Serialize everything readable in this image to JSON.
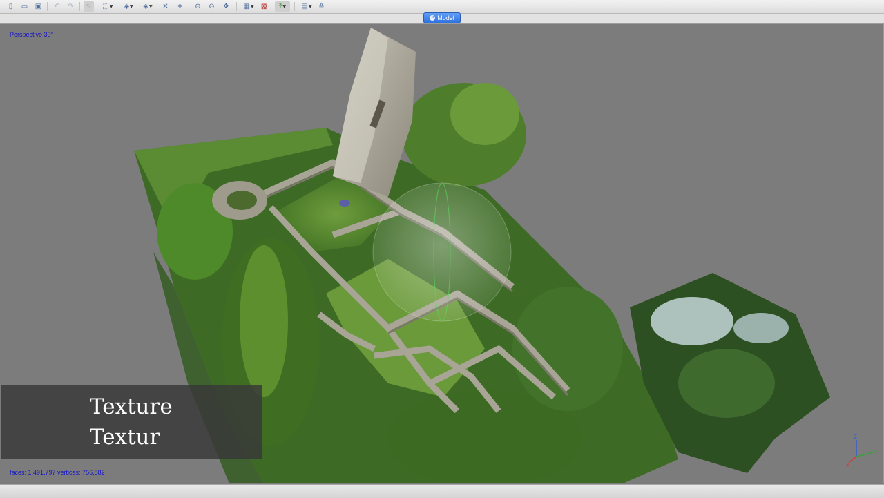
{
  "toolbar": {
    "buttons": [
      {
        "name": "new-file-icon",
        "glyph": "▯"
      },
      {
        "name": "open-folder-icon",
        "glyph": "▭"
      },
      {
        "name": "save-icon",
        "glyph": "▣"
      },
      {
        "name": "undo-icon",
        "glyph": "↶"
      },
      {
        "name": "redo-icon",
        "glyph": "↷"
      },
      {
        "name": "select-cursor-icon",
        "glyph": "↖"
      },
      {
        "name": "rectangle-select-icon",
        "glyph": "⬚"
      },
      {
        "name": "add-point-icon",
        "glyph": "◈"
      },
      {
        "name": "move-point-icon",
        "glyph": "◈"
      },
      {
        "name": "delete-icon",
        "glyph": "✕"
      },
      {
        "name": "crop-icon",
        "glyph": "⌗"
      },
      {
        "name": "zoom-in-icon",
        "glyph": "⊕"
      },
      {
        "name": "zoom-out-icon",
        "glyph": "⊖"
      },
      {
        "name": "navigate-icon",
        "glyph": "✥"
      },
      {
        "name": "grid-view-icon",
        "glyph": "▦"
      },
      {
        "name": "mosaic-icon",
        "glyph": "▩"
      },
      {
        "name": "reset-view-icon",
        "glyph": "⤒"
      },
      {
        "name": "show-cameras-icon",
        "glyph": "▤"
      },
      {
        "name": "show-layers-icon",
        "glyph": "≙"
      }
    ]
  },
  "tab": {
    "close_glyph": "×",
    "label": "Model"
  },
  "viewport": {
    "view_mode": "Perspective 30°",
    "stats": "faces: 1,491,797 vertices: 756,882",
    "background_color": "#7d7c7d"
  },
  "caption": {
    "line1": "Texture",
    "line2": "Textur"
  },
  "axes": {
    "z": "Z",
    "y": "Y",
    "x": "X",
    "colors": {
      "x": "#d23a3a",
      "y": "#3aa03a",
      "z": "#3a5ad2"
    }
  }
}
